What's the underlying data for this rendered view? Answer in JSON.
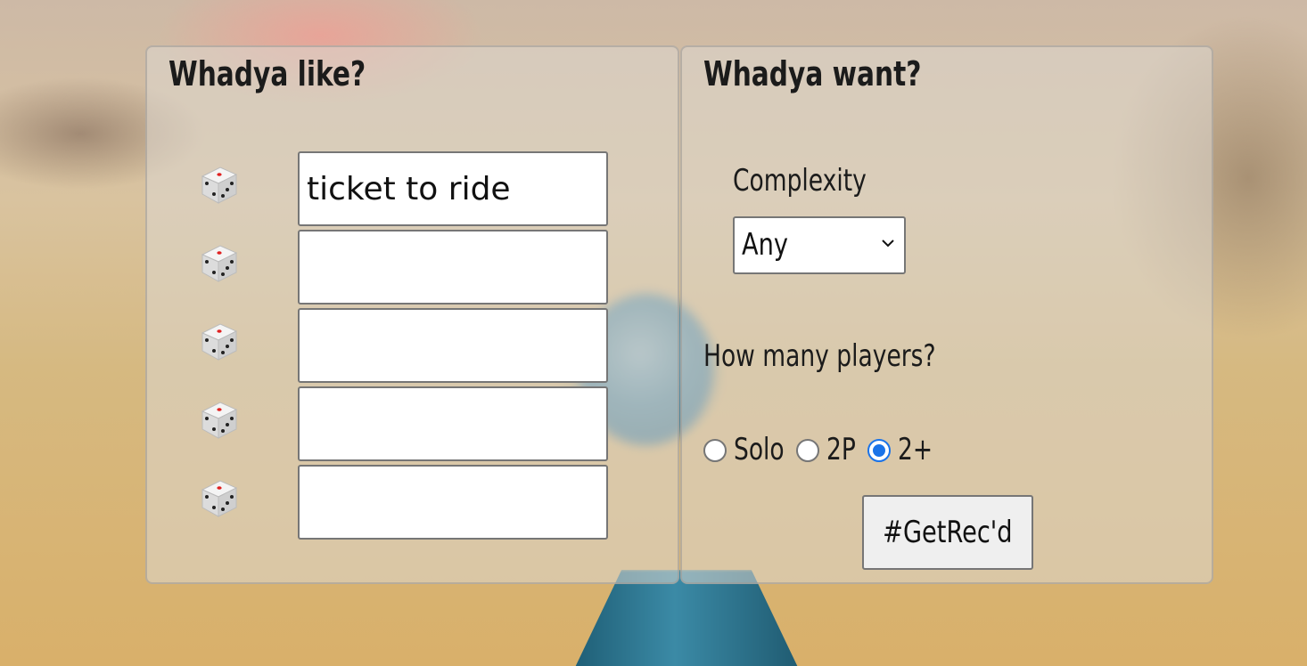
{
  "left_panel": {
    "title": "Whadya like?",
    "games": [
      {
        "icon": "dice-icon",
        "value": "ticket to ride"
      },
      {
        "icon": "dice-icon",
        "value": ""
      },
      {
        "icon": "dice-icon",
        "value": ""
      },
      {
        "icon": "dice-icon",
        "value": ""
      },
      {
        "icon": "dice-icon",
        "value": ""
      }
    ]
  },
  "right_panel": {
    "title": "Whadya want?",
    "complexity_label": "Complexity",
    "complexity_selected": "Any",
    "players_label": "How many players?",
    "player_options": [
      {
        "label": "Solo",
        "checked": false
      },
      {
        "label": "2P",
        "checked": false
      },
      {
        "label": "2+",
        "checked": true
      }
    ],
    "submit_label": "#GetRec'd"
  },
  "colors": {
    "radio_accent": "#1a73e8",
    "dice_pip_accent": "#e02020"
  }
}
